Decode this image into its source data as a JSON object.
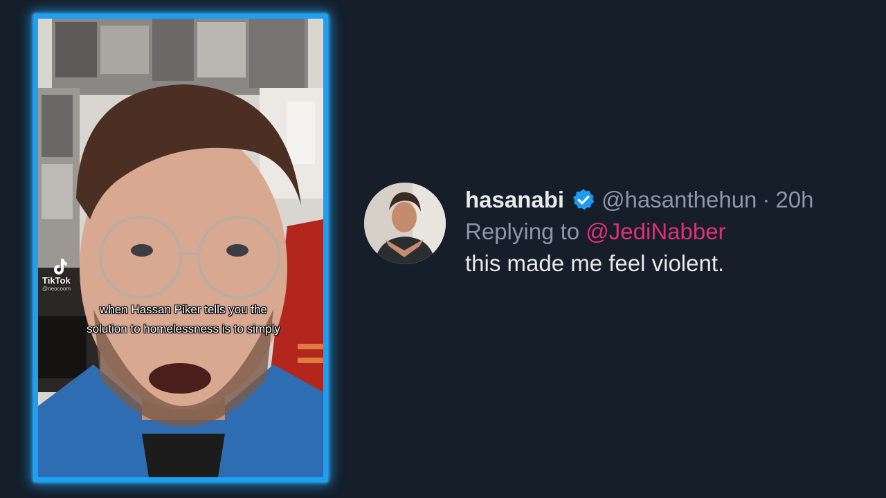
{
  "video": {
    "platform_label": "TikTok",
    "platform_handle": "@neocoom",
    "caption": "when Hassan Piker tells you the solution to homelessness is to simply",
    "icon": "tiktok-logo-icon",
    "frame_color": "#1ea0f2"
  },
  "tweet": {
    "display_name": "hasanabi",
    "verified_icon": "verified-badge-icon",
    "handle": "@hasanthehun",
    "separator": "·",
    "time": "20h",
    "reply_prefix": "Replying to",
    "reply_to": "@JediNabber",
    "text": "this made me feel violent.",
    "colors": {
      "name": "#e7e9ea",
      "muted": "#8b98a5",
      "mention": "#e0307a",
      "verified": "#1d9bf0"
    }
  },
  "colors": {
    "background": "#151e29"
  }
}
